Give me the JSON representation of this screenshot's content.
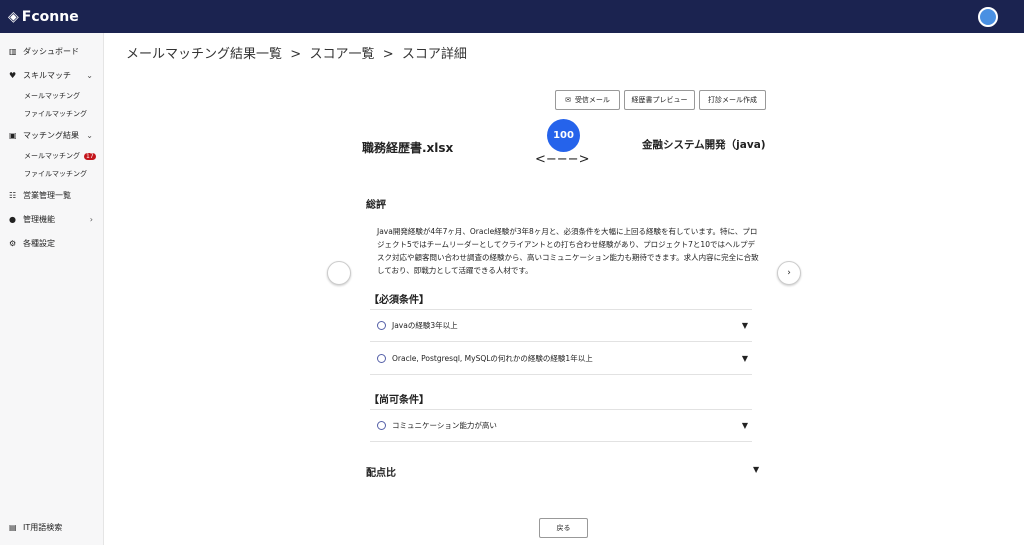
{
  "app": {
    "logo": "Fconne"
  },
  "sidebar": {
    "items": [
      {
        "label": "ダッシュボード",
        "icon": "dashboard-icon"
      },
      {
        "label": "スキルマッチ",
        "icon": "heart-icon",
        "subs": [
          "メールマッチング",
          "ファイルマッチング"
        ]
      },
      {
        "label": "マッチング結果",
        "icon": "clipboard-icon",
        "subs": [
          "メールマッチング",
          "ファイルマッチング"
        ],
        "badge": "17"
      },
      {
        "label": "営業管理一覧",
        "icon": "team-icon"
      },
      {
        "label": "管理機能",
        "icon": "person-icon"
      },
      {
        "label": "各種設定",
        "icon": "gear-icon"
      }
    ],
    "footer": "IT用語検索"
  },
  "breadcrumb": [
    "メールマッチング結果一覧",
    ">",
    "スコア一覧",
    ">",
    "スコア詳細"
  ],
  "buttons": {
    "inbox": "受信メール",
    "preview": "経歴書プレビュー",
    "draft": "打診メール作成",
    "back": "戻る"
  },
  "match": {
    "left": "職務経歴書.xlsx",
    "score": "100",
    "arrow": "<−−−>",
    "right": "金融システム開発（java)"
  },
  "review": {
    "title": "総評",
    "text": "Java開発経験が4年7ヶ月、Oracle経験が3年8ヶ月と、必須条件を大幅に上回る経験を有しています。特に、プロジェクト5ではチームリーダーとしてクライアントとの打ち合わせ経験があり、プロジェクト7と10ではヘルプデスク対応や顧客問い合わせ調査の経験から、高いコミュニケーション能力も期待できます。求人内容に完全に合致しており、即戦力として活躍できる人材です。"
  },
  "required": {
    "title": "【必須条件】",
    "items": [
      "Javaの経験3年以上",
      "Oracle, Postgresql, MySQLの何れかの経験の経験1年以上"
    ]
  },
  "preferred": {
    "title": "【尚可条件】",
    "items": [
      "コミュニケーション能力が高い"
    ]
  },
  "ratio": {
    "title": "配点比"
  }
}
